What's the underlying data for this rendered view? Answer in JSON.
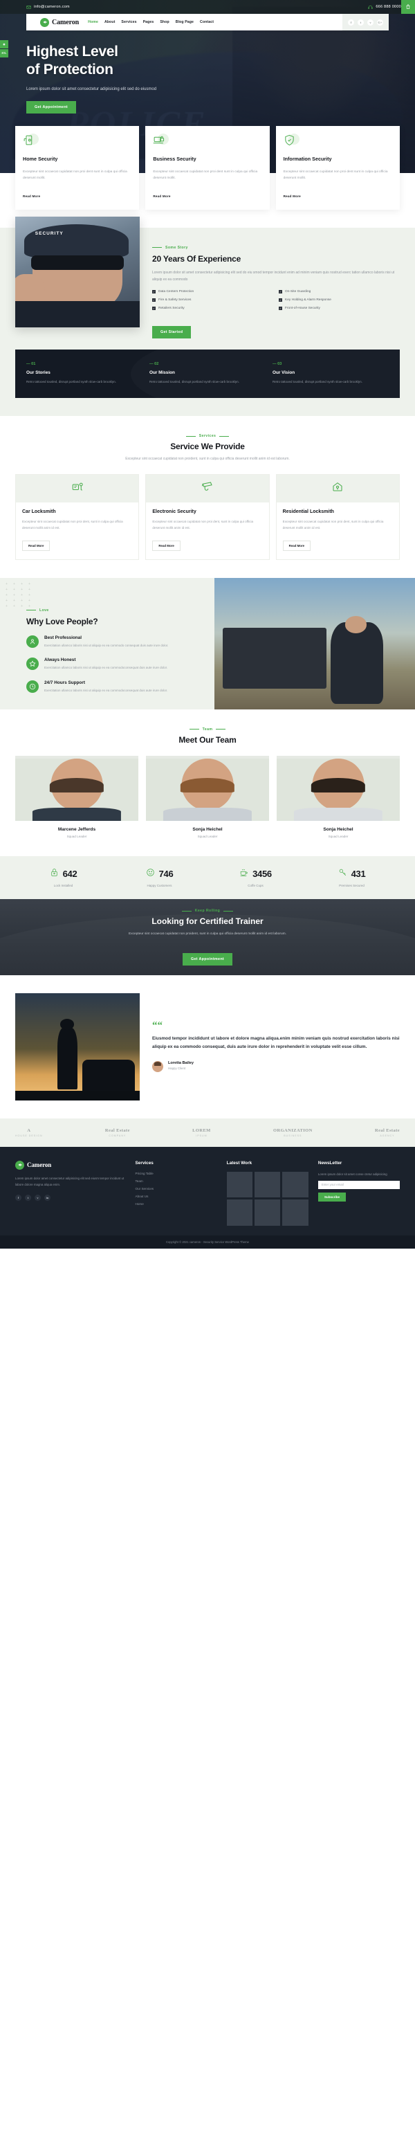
{
  "topbar": {
    "email": "info@cameron.com",
    "phone": "666 888 0000",
    "cart_icon": "shopping-bag-icon",
    "mail_icon": "mail-icon",
    "headset_icon": "headset-icon"
  },
  "nav": {
    "brand": "Cameron",
    "items": [
      {
        "label": "Home",
        "active": true
      },
      {
        "label": "About",
        "active": false
      },
      {
        "label": "Services",
        "active": false
      },
      {
        "label": "Pages",
        "active": false
      },
      {
        "label": "Shop",
        "active": false
      },
      {
        "label": "Blog Page",
        "active": false
      },
      {
        "label": "Contact",
        "active": false
      }
    ],
    "social": [
      "f",
      "t",
      "v",
      "G+"
    ]
  },
  "float_badges": [
    {
      "label": "◉"
    },
    {
      "label": "RTL"
    }
  ],
  "hero": {
    "title_line1": "Highest Level",
    "title_line2": "of Protection",
    "subtitle": "Lorem ipsum dolor sit amet consectetur adipisicing elit sed do eiusmod",
    "cta": "Get Appointment",
    "bg_word": "POLICE"
  },
  "features": [
    {
      "icon": "door-lock-icon",
      "title": "Home\nSecurity",
      "text": "Excepteur sint occaecat cupidatat non proi dent sunt in culpa qui officia deserunt mollit.",
      "link": "Read More"
    },
    {
      "icon": "laptop-lock-icon",
      "title": "Business\nSecurity",
      "text": "Excepteur sint occaecat cupidatat non proi dent sunt in culpa qui officia deserunt mollit.",
      "link": "Read More"
    },
    {
      "icon": "shield-data-icon",
      "title": "Information\nSecurity",
      "text": "Excepteur sint occaecat cupidatat non proi dent sunt in culpa qui officia deserunt mollit.",
      "link": "Read More"
    }
  ],
  "experience": {
    "eyebrow": "Some Story",
    "title": "20 Years Of Experience",
    "text": "Lorem ipsum dolor sit amet consectetur adipisicing elit sed do eiu smod tempor incidunt enim ad minim veniam quis nostrud exerc tation ullamco laboris nisi ut aliquip ex ea commodo",
    "checks": [
      "Data Centers Protection",
      "On-Site Guarding",
      "Fire & Safety Services",
      "Key Holding & Alarm Response",
      "Retailers Security",
      "Front-of-House Security"
    ],
    "cta": "Get Started",
    "image_caption": "SECURITY"
  },
  "stories": [
    {
      "num": "— 01",
      "title": "Our Stories",
      "text": "Retro tattooed tousled, disrupt portland synth slow-carb brooklyn."
    },
    {
      "num": "— 02",
      "title": "Our Mission",
      "text": "Retro tattooed tousled, disrupt portland synth slow-carb brooklyn."
    },
    {
      "num": "— 03",
      "title": "Our Vision",
      "text": "Retro tattooed tousled, disrupt portland synth slow-carb brooklyn."
    }
  ],
  "services": {
    "eyebrow": "Services",
    "title": "Service We Provide",
    "lead": "Excepteur sint occaecat cupidatat non proident, sunt in culpa qui officia deserunt mollit anim id est laborum.",
    "items": [
      {
        "icon": "car-key-icon",
        "title": "Car Locksmith",
        "text": "Excepteur sint occaecat cupidatat non proi dent, sunt in culpa qui officia deserunt mollit anim id est.",
        "link": "Read More"
      },
      {
        "icon": "cctv-camera-icon",
        "title": "Electronic Security",
        "text": "Excepteur sint occaecat cupidatat non proi dent, sunt in culpa qui officia deserunt mollit anim id est.",
        "link": "Read More"
      },
      {
        "icon": "house-key-icon",
        "title": "Residential Locksmith",
        "text": "Excepteur sint occaecat cupidatat non proi dent, sunt in culpa qui officia deserunt mollit anim id est.",
        "link": "Read More"
      }
    ]
  },
  "why": {
    "eyebrow": "Love",
    "title": "Why Love People?",
    "items": [
      {
        "icon": "user-icon",
        "title": "Best Professional",
        "text": "Exercitation ullamco laboris nisi ut aliquip ex ea commodo consequat duis aute irure dolor."
      },
      {
        "icon": "star-icon",
        "title": "Always Honest",
        "text": "Exercitation ullamco laboris nisi ut aliquip ex ea commodoconsequat duis aute irure dolor."
      },
      {
        "icon": "clock-icon",
        "title": "24/7 Hours Support",
        "text": "Exercitation ullamco laboris nisi ut aliquip ex ea commodoconsequat duis aute irure dolor."
      }
    ]
  },
  "team": {
    "eyebrow": "Team",
    "title": "Meet Our Team",
    "members": [
      {
        "name": "Marcene Jefferds",
        "role": "Squad Leader"
      },
      {
        "name": "Sonja Heichel",
        "role": "Squad Leader"
      },
      {
        "name": "Sonja Heichel",
        "role": "Squad Leader"
      }
    ]
  },
  "counters": [
    {
      "icon": "padlock-icon",
      "value": "642",
      "label": "Lock Installed"
    },
    {
      "icon": "smiley-icon",
      "value": "746",
      "label": "Happy Customers"
    },
    {
      "icon": "coffee-cup-icon",
      "value": "3456",
      "label": "Coffe Cups"
    },
    {
      "icon": "key-icon",
      "value": "431",
      "label": "Premises Secured"
    }
  ],
  "cta_band": {
    "eyebrow": "Keep Rolling",
    "title": "Looking for Certified Trainer",
    "text": "Excepteur sint occaecat cupidatat non proident, sunt in culpa qui officia deserunt mollit anim id est laborum.",
    "button": "Get Appointment"
  },
  "testimonial": {
    "quote_mark": "““",
    "text": "Eiusmod tempor incididunt ut labore et dolore magna aliqua.enim minim veniam quis nostrud exercitation laboris nisi aliquip ex ea commodo consequat, duis aute irure dolor in reprehenderit in voluptate velit esse cillum.",
    "author": "Loretta Bailey",
    "role": "Happy Client"
  },
  "brands": [
    {
      "name": "A",
      "sub": "HOUSE DESIGN"
    },
    {
      "name": "Real Estate",
      "sub": "COMPANY"
    },
    {
      "name": "LOREM",
      "sub": "IPSUM"
    },
    {
      "name": "ORGANIZATION",
      "sub": "BUSINESS"
    },
    {
      "name": "Real Estate",
      "sub": "AGENCY"
    }
  ],
  "footer": {
    "brand": "Cameron",
    "about": "Lorem ipsum dolor amet consectetur adipisicing elit sed eiusm tempor incidunt ut labore dolore magna aliqua enim.",
    "social": [
      "f",
      "t",
      "v",
      "in"
    ],
    "services_title": "Services",
    "services": [
      "Pricing Table",
      "Team",
      "Our Services",
      "About Us",
      "Home"
    ],
    "work_title": "Latest Work",
    "newsletter_title": "NewsLetter",
    "newsletter_text": "Lorem ipsum dolor sit amet conse ctetur adipisicing",
    "newsletter_placeholder": "Enter your email",
    "newsletter_button": "Subscribe",
    "copyright": "Copyright © 2021 cameron - Security Service WordPress Theme"
  }
}
